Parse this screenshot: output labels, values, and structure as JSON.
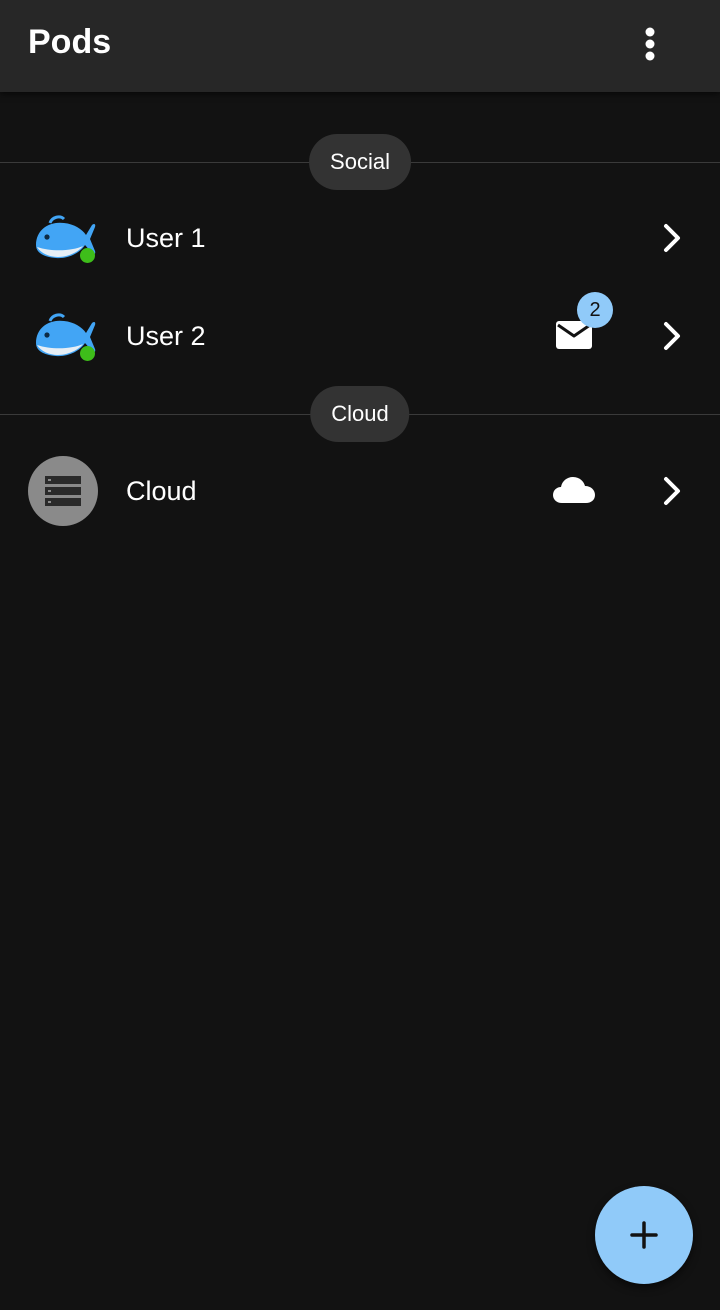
{
  "appbar": {
    "title": "Pods",
    "menu_icon": "more-vert-icon"
  },
  "sections": [
    {
      "label": "Social",
      "items": [
        {
          "label": "User 1",
          "avatar": "whale-avatar",
          "online": true,
          "status_color": "#3ebd1a",
          "trailing_icon": "chevron-right-icon"
        },
        {
          "label": "User 2",
          "avatar": "whale-avatar",
          "online": true,
          "status_color": "#3ebd1a",
          "indicator_icon": "mail-icon",
          "badge": "2",
          "trailing_icon": "chevron-right-icon"
        }
      ]
    },
    {
      "label": "Cloud",
      "items": [
        {
          "label": "Cloud",
          "avatar": "server-icon",
          "indicator_icon": "cloud-icon",
          "trailing_icon": "chevron-right-icon"
        }
      ]
    }
  ],
  "fab": {
    "icon": "add-icon"
  },
  "colors": {
    "background": "#121212",
    "appbar": "#272727",
    "chip": "#333333",
    "accent": "#90caf9",
    "online": "#3ebd1a",
    "whale": "#42a5f5"
  }
}
